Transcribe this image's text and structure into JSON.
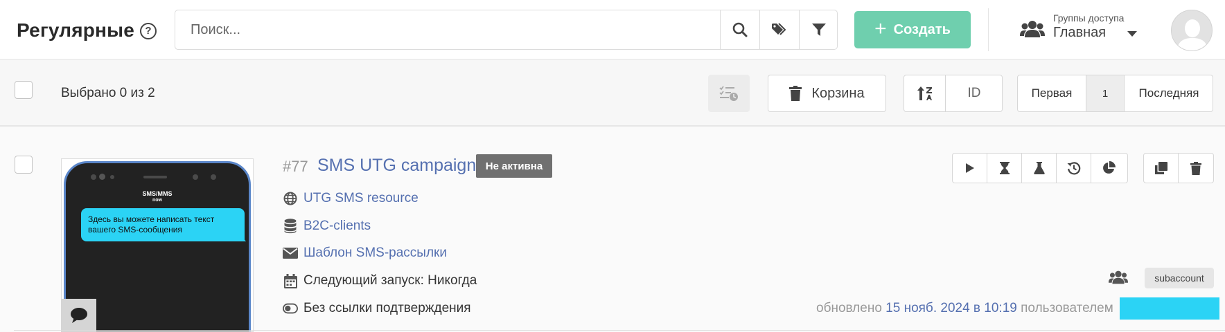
{
  "header": {
    "title": "Регулярные",
    "help_label": "?",
    "search_placeholder": "Поиск...",
    "create_label": "Создать",
    "access_group": {
      "caption": "Группы доступа",
      "value": "Главная"
    }
  },
  "toolbar": {
    "selected_text": "Выбрано 0 из 2",
    "trash_label": "Корзина",
    "sort_field": "ID",
    "pager": {
      "first": "Первая",
      "current": "1",
      "last": "Последняя"
    }
  },
  "campaign": {
    "id": "#77",
    "name": "SMS UTG campaign",
    "status": "Не активна",
    "resource": "UTG SMS resource",
    "segment": "B2C-clients",
    "template": "Шаблон SMS-рассылки",
    "next_run": "Следующий запуск: Никогда",
    "confirmation": "Без ссылки подтверждения",
    "preview": {
      "sender": "SMS/MMS",
      "sender_sub": "now",
      "message": "Здесь вы можете написать текст вашего SMS-сообщения"
    },
    "account_badge": "subaccount",
    "updated_prefix": "обновлено",
    "updated_date": "15 нояб. 2024 в 10:19",
    "updated_suffix": "пользователем"
  },
  "colors": {
    "accent_green": "#6fcfae",
    "link_blue": "#5570b0",
    "status_gray": "#707070",
    "sms_bubble": "#2bd3f5"
  },
  "icons": {
    "header": [
      "help-icon",
      "search-icon",
      "tag-icon",
      "filter-icon",
      "plus-icon",
      "group-icon",
      "chevron-down-icon",
      "avatar"
    ],
    "toolbar": [
      "checklist-clock-icon",
      "trash-icon",
      "sort-icon"
    ],
    "actions": [
      "play-icon",
      "hourglass-icon",
      "flask-icon",
      "history-icon",
      "pie-chart-icon",
      "copy-icon",
      "trash-icon"
    ],
    "meta": [
      "globe-icon",
      "database-icon",
      "envelope-icon",
      "calendar-icon",
      "toggle-off-icon",
      "chat-bubble-icon"
    ]
  }
}
